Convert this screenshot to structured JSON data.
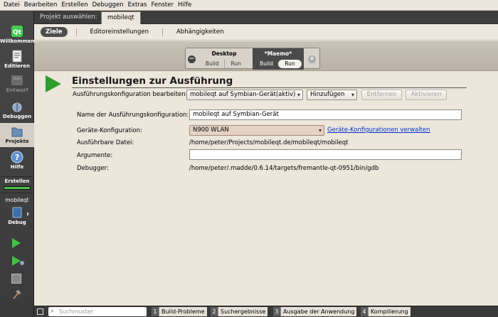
{
  "menu": [
    "Datei",
    "Bearbeiten",
    "Erstellen",
    "Debuggen",
    "Extras",
    "Fenster",
    "Hilfe"
  ],
  "sidebar": {
    "modes": [
      {
        "label": "Willkommen",
        "icon": "qt-logo-icon"
      },
      {
        "label": "Editieren",
        "icon": "edit-document-icon"
      },
      {
        "label": "Entwurf",
        "icon": "design-icon"
      },
      {
        "label": "Debuggen",
        "icon": "debug-bug-icon"
      },
      {
        "label": "Projekte",
        "icon": "folder-icon"
      },
      {
        "label": "Hilfe",
        "icon": "help-question-icon"
      }
    ],
    "build_label": "Erstellen",
    "project_label": "mobileqt",
    "target_label": "Debug",
    "build_progress": 1.0
  },
  "project_bar": {
    "label": "Projekt auswählen:",
    "tab": "mobileqt"
  },
  "subtabs": [
    "Ziele",
    "Editoreinstellungen",
    "Abhängigkeiten"
  ],
  "targets": {
    "desktop": {
      "title": "Desktop",
      "build": "Build",
      "run": "Run"
    },
    "maemo": {
      "title": "*Maemo*",
      "build": "Build",
      "run": "Run"
    },
    "remove": "−",
    "add": "+"
  },
  "run_settings": {
    "heading": "Einstellungen zur Ausführung",
    "edit_label": "Ausführungskonfiguration bearbeiten:",
    "config_value": "mobileqt auf Symbian-Gerät(aktiv)",
    "add_button": "Hinzufügen",
    "remove_button": "Entfernen",
    "activate_button": "Aktivieren",
    "name_label": "Name der Ausführungskonfiguration:",
    "name_value": "mobileqt auf Symbian-Gerät",
    "device_label": "Geräte-Konfiguration:",
    "device_value": "N900 WLAN",
    "device_link": "Geräte-Konfigurationen verwalten",
    "exe_label": "Ausführbare Datei:",
    "exe_value": "/home/peter/Projects/mobileqt.de/mobileqt/mobileqt",
    "args_label": "Argumente:",
    "args_value": "",
    "debugger_label": "Debugger:",
    "debugger_value": "/home/peter/.madde/0.6.14/targets/fremantle-qt-0951/bin/gdb"
  },
  "statusbar": {
    "search_placeholder": "Suchmuster",
    "panes": [
      {
        "num": "1",
        "label": "Build-Probleme"
      },
      {
        "num": "2",
        "label": "Suchergebnisse"
      },
      {
        "num": "3",
        "label": "Ausgabe der Anwendung"
      },
      {
        "num": "4",
        "label": "Kompilierung"
      }
    ]
  },
  "colors": {
    "accent_green": "#2e9e2e",
    "link_blue": "#0033cc",
    "sidebar_bg": "#3f3f3f"
  }
}
